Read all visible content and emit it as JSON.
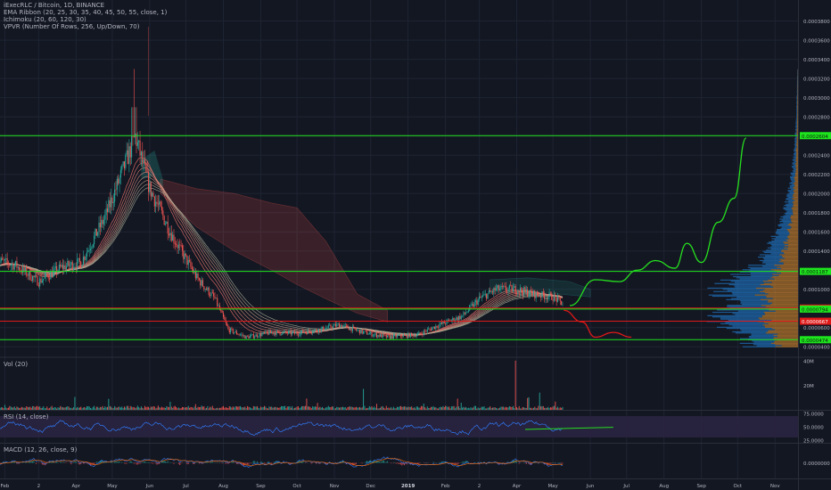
{
  "header": {
    "symbol_line": "iExecRLC / Bitcoin, 1D, BINANCE",
    "indicators": [
      "EMA Ribbon (20, 25, 30, 35, 40, 45, 50, 55, close, 1)",
      "Ichimoku (20, 60, 120, 30)",
      "VPVR (Number Of Rows, 256, Up/Down, 70)"
    ]
  },
  "colors": {
    "background": "#131722",
    "grid": "#1f2433",
    "up": "#26a69a",
    "down": "#ef5350",
    "level_line": "#1ee41e",
    "projection_green": "#26e01f",
    "projection_red": "#e01818",
    "rsi": "#3179f5",
    "rsi_band": "#2a2340",
    "vpvr_blue": "#1f6fb8",
    "vpvr_orange": "#c8822e",
    "axis_text": "#b2b5be"
  },
  "panes": {
    "vol_label": "Vol (20)",
    "rsi_label": "RSI (14, close)",
    "macd_label": "MACD (12, 26, close, 9)"
  },
  "chart_data": [
    {
      "type": "candlestick",
      "pane": "price",
      "ylim": [
        3e-05,
        0.000402
      ],
      "y_ticks": [
        "0.0003800",
        "0.0003600",
        "0.0003400",
        "0.0003200",
        "0.0003000",
        "0.0002800",
        "0.0002600",
        "0.0002400",
        "0.0002200",
        "0.0002000",
        "0.0001800",
        "0.0001600",
        "0.0001400",
        "0.0001200",
        "0.0001000",
        "0.0000800",
        "0.0000600",
        "0.0000400"
      ],
      "x_ticks": [
        "Feb",
        "2",
        "Apr",
        "May",
        "Jun",
        "Jul",
        "Aug",
        "Sep",
        "Oct",
        "Nov",
        "Dec",
        "2019",
        "Feb",
        "2",
        "Apr",
        "May",
        "Jun",
        "Jul",
        "Aug",
        "Sep",
        "Oct",
        "Nov"
      ],
      "price_path": [
        {
          "date": "2018-01-25",
          "close": 0.00013
        },
        {
          "date": "2018-02-10",
          "close": 0.000125
        },
        {
          "date": "2018-03-01",
          "close": 0.000108
        },
        {
          "date": "2018-03-20",
          "close": 0.000123
        },
        {
          "date": "2018-04-05",
          "close": 0.000128
        },
        {
          "date": "2018-04-25",
          "close": 0.000175
        },
        {
          "date": "2018-05-10",
          "close": 0.000225
        },
        {
          "date": "2018-05-20",
          "close": 0.00026
        },
        {
          "date": "2018-06-01",
          "close": 0.000205
        },
        {
          "date": "2018-06-20",
          "close": 0.000155
        },
        {
          "date": "2018-07-10",
          "close": 0.000112
        },
        {
          "date": "2018-07-25",
          "close": 9e-05
        },
        {
          "date": "2018-08-05",
          "close": 5.8e-05
        },
        {
          "date": "2018-08-20",
          "close": 5e-05
        },
        {
          "date": "2018-09-10",
          "close": 5.5e-05
        },
        {
          "date": "2018-10-01",
          "close": 5.4e-05
        },
        {
          "date": "2018-10-20",
          "close": 5.8e-05
        },
        {
          "date": "2018-11-05",
          "close": 6.3e-05
        },
        {
          "date": "2018-11-25",
          "close": 5.5e-05
        },
        {
          "date": "2018-12-15",
          "close": 5e-05
        },
        {
          "date": "2019-01-10",
          "close": 5.3e-05
        },
        {
          "date": "2019-01-25",
          "close": 6.2e-05
        },
        {
          "date": "2019-02-15",
          "close": 7.2e-05
        },
        {
          "date": "2019-03-01",
          "close": 9e-05
        },
        {
          "date": "2019-03-15",
          "close": 0.0001
        },
        {
          "date": "2019-04-01",
          "close": 0.0001
        },
        {
          "date": "2019-04-15",
          "close": 9.5e-05
        },
        {
          "date": "2019-05-01",
          "close": 9.2e-05
        },
        {
          "date": "2019-05-09",
          "close": 8.5e-05
        }
      ],
      "horizontal_levels": [
        {
          "value": 0.0002604,
          "label": "0.0002604",
          "color": "#1ee41e"
        },
        {
          "value": 0.0001187,
          "label": "0.0001187",
          "color": "#1ee41e"
        },
        {
          "value": 8.04e-05,
          "label": "0.0000804",
          "color": "#e01818"
        },
        {
          "value": 7.94e-05,
          "label": "0.0000794",
          "color": "#1ee41e"
        },
        {
          "value": 6.67e-05,
          "label": "0.0000667",
          "color": "#e01818"
        },
        {
          "value": 4.74e-05,
          "label": "0.0000474",
          "color": "#1ee41e"
        }
      ],
      "projection_bullish": [
        {
          "date": "2019-05-15",
          "value": 8.3e-05
        },
        {
          "date": "2019-06-05",
          "value": 0.00011
        },
        {
          "date": "2019-06-25",
          "value": 0.000108
        },
        {
          "date": "2019-07-10",
          "value": 0.00012
        },
        {
          "date": "2019-07-25",
          "value": 0.00013
        },
        {
          "date": "2019-08-10",
          "value": 0.000122
        },
        {
          "date": "2019-08-20",
          "value": 0.000148
        },
        {
          "date": "2019-09-01",
          "value": 0.000128
        },
        {
          "date": "2019-09-15",
          "value": 0.00017
        },
        {
          "date": "2019-09-28",
          "value": 0.000195
        },
        {
          "date": "2019-10-08",
          "value": 0.000258
        }
      ],
      "projection_bearish": [
        {
          "date": "2019-05-10",
          "value": 7.8e-05
        },
        {
          "date": "2019-05-25",
          "value": 6.6e-05
        },
        {
          "date": "2019-06-05",
          "value": 5e-05
        },
        {
          "date": "2019-06-20",
          "value": 5.5e-05
        },
        {
          "date": "2019-07-05",
          "value": 5e-05
        }
      ]
    },
    {
      "type": "bar",
      "pane": "volume",
      "y_ticks": [
        "40M",
        "20M"
      ],
      "ylim": [
        0,
        42000000
      ]
    },
    {
      "type": "line",
      "pane": "rsi",
      "y_ticks": [
        "75.0000",
        "50.0000",
        "25.0000"
      ],
      "ylim": [
        20,
        80
      ]
    },
    {
      "type": "line",
      "pane": "macd",
      "y_ticks": [
        "0.0000000"
      ]
    }
  ]
}
